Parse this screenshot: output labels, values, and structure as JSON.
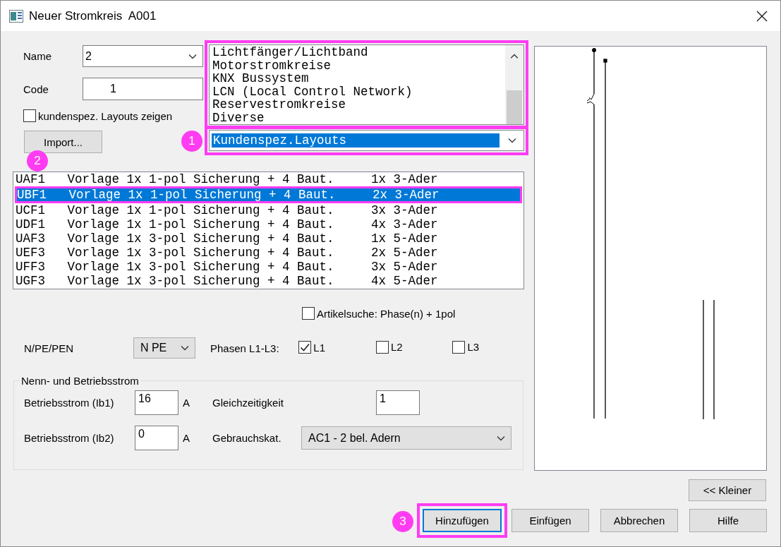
{
  "window": {
    "title": "Neuer Stromkreis  A001"
  },
  "name_field": {
    "label": "Name",
    "value": "2"
  },
  "code_field": {
    "label": "Code",
    "value": "1"
  },
  "show_custom_layouts": {
    "label": "kundenspez. Layouts zeigen",
    "checked": false
  },
  "import_button": "Import...",
  "category_list": {
    "items": [
      "Lichtfänger/Lichtband",
      "Motorstromkreise",
      "KNX Bussystem",
      "LCN (Local Control Network)",
      "Reservestromkreise",
      "Diverse"
    ],
    "value": "Kundenspez.Layouts"
  },
  "templates": {
    "rows": [
      {
        "text": "UAF1   Vorlage 1x 1-pol Sicherung + 4 Baut.     1x 3-Ader",
        "selected": false
      },
      {
        "text": "UBF1   Vorlage 1x 1-pol Sicherung + 4 Baut.     2x 3-Ader",
        "selected": true
      },
      {
        "text": "UCF1   Vorlage 1x 1-pol Sicherung + 4 Baut.     3x 3-Ader",
        "selected": false
      },
      {
        "text": "UDF1   Vorlage 1x 1-pol Sicherung + 4 Baut.     4x 3-Ader",
        "selected": false
      },
      {
        "text": "UAF3   Vorlage 1x 3-pol Sicherung + 4 Baut.     1x 5-Ader",
        "selected": false
      },
      {
        "text": "UEF3   Vorlage 1x 3-pol Sicherung + 4 Baut.     2x 5-Ader",
        "selected": false
      },
      {
        "text": "UFF3   Vorlage 1x 3-pol Sicherung + 4 Baut.     3x 5-Ader",
        "selected": false
      },
      {
        "text": "UGF3   Vorlage 1x 3-pol Sicherung + 4 Baut.     4x 5-Ader",
        "selected": false
      }
    ]
  },
  "article_search": {
    "label": "Artikelsuche: Phase(n) + 1pol",
    "checked": false
  },
  "conductor": {
    "label": "N/PE/PEN",
    "value": "N PE"
  },
  "phases": {
    "label": "Phasen L1-L3:",
    "items": [
      {
        "label": "L1",
        "checked": true
      },
      {
        "label": "L2",
        "checked": false
      },
      {
        "label": "L3",
        "checked": false
      }
    ]
  },
  "current_group": {
    "title": "Nenn- und Betriebsstrom",
    "currents": [
      {
        "label": "Betriebsstrom (Ib1)",
        "value": "16",
        "unit": "A"
      },
      {
        "label": "Betriebsstrom (Ib2)",
        "value": "0",
        "unit": "A"
      }
    ],
    "simultaneity": {
      "label": "Gleichzeitigkeit",
      "value": "1"
    },
    "usage_category": {
      "label": "Gebrauchskat.",
      "value": "AC1 - 2 bel. Adern"
    }
  },
  "buttons": [
    {
      "label": "<< Kleiner",
      "focused": false
    },
    {
      "label": "Hinzufügen",
      "focused": true
    },
    {
      "label": "Einfügen",
      "focused": false
    },
    {
      "label": "Abbrechen",
      "focused": false
    },
    {
      "label": "Hilfe",
      "focused": false
    }
  ],
  "annotations": [
    "1",
    "2",
    "3"
  ]
}
